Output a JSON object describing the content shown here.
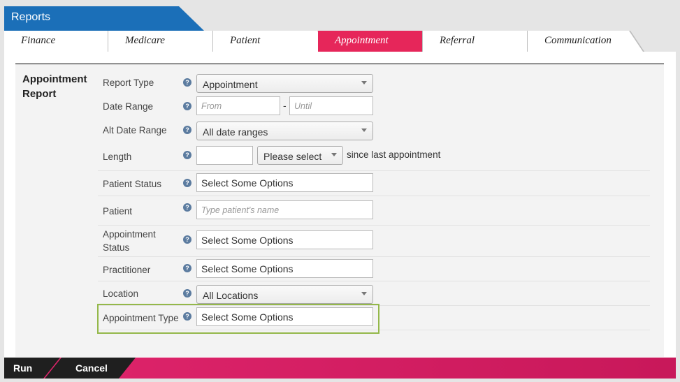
{
  "header": {
    "title": "Reports"
  },
  "tabs": [
    {
      "label": "Finance"
    },
    {
      "label": "Medicare"
    },
    {
      "label": "Patient"
    },
    {
      "label": "Appointment",
      "active": true
    },
    {
      "label": "Referral"
    },
    {
      "label": "Communication"
    }
  ],
  "section": {
    "title": "Appointment Report"
  },
  "form": {
    "help_glyph": "?",
    "report_type": {
      "label": "Report Type",
      "value": "Appointment"
    },
    "date_range": {
      "label": "Date Range",
      "from_placeholder": "From",
      "until_placeholder": "Until",
      "separator": "-"
    },
    "alt_date_range": {
      "label": "Alt Date Range",
      "value": "All date ranges"
    },
    "length": {
      "label": "Length",
      "value": "",
      "unit_value": "Please select",
      "suffix": "since last appointment"
    },
    "patient_status": {
      "label": "Patient Status",
      "value": "Select Some Options"
    },
    "patient": {
      "label": "Patient",
      "placeholder": "Type patient's name"
    },
    "appointment_status": {
      "label": "Appointment Status",
      "value": "Select Some Options"
    },
    "practitioner": {
      "label": "Practitioner",
      "value": "Select Some Options"
    },
    "location": {
      "label": "Location",
      "value": "All Locations"
    },
    "appointment_type": {
      "label": "Appointment Type",
      "value": "Select Some Options"
    }
  },
  "footer": {
    "run_label": "Run",
    "cancel_label": "Cancel"
  },
  "colors": {
    "brand_blue": "#1b6fb8",
    "accent_pink": "#e6265a",
    "highlight_green": "#94b84a"
  }
}
